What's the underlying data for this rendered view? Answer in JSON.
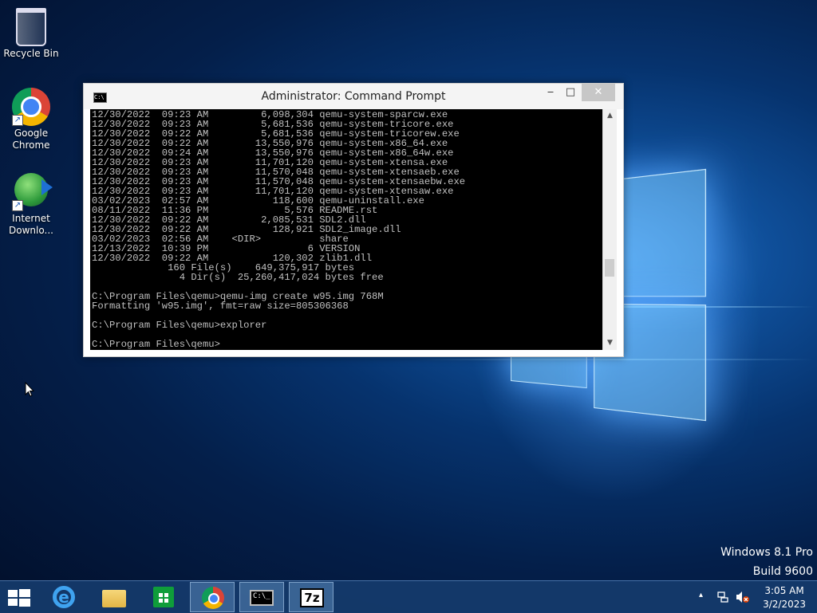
{
  "desktop": {
    "icons": [
      {
        "label": "Recycle Bin"
      },
      {
        "label": "Google Chrome"
      },
      {
        "label": "Internet Downlo..."
      }
    ],
    "watermark": {
      "line1": "Windows 8.1 Pro",
      "line2": "Build 9600"
    }
  },
  "window": {
    "title": "Administrator: Command Prompt",
    "minimize": "‒",
    "maximize": "□",
    "close": "✕",
    "console_lines": [
      "12/30/2022  09:23 AM         6,098,304 qemu-system-sparcw.exe",
      "12/30/2022  09:23 AM         5,681,536 qemu-system-tricore.exe",
      "12/30/2022  09:22 AM         5,681,536 qemu-system-tricorew.exe",
      "12/30/2022  09:22 AM        13,550,976 qemu-system-x86_64.exe",
      "12/30/2022  09:24 AM        13,550,976 qemu-system-x86_64w.exe",
      "12/30/2022  09:23 AM        11,701,120 qemu-system-xtensa.exe",
      "12/30/2022  09:23 AM        11,570,048 qemu-system-xtensaeb.exe",
      "12/30/2022  09:23 AM        11,570,048 qemu-system-xtensaebw.exe",
      "12/30/2022  09:23 AM        11,701,120 qemu-system-xtensaw.exe",
      "03/02/2023  02:57 AM           118,600 qemu-uninstall.exe",
      "08/11/2022  11:36 PM             5,576 README.rst",
      "12/30/2022  09:22 AM         2,085,531 SDL2.dll",
      "12/30/2022  09:22 AM           128,921 SDL2_image.dll",
      "03/02/2023  02:56 AM    <DIR>          share",
      "12/13/2022  10:39 PM                 6 VERSION",
      "12/30/2022  09:22 AM           120,302 zlib1.dll",
      "             160 File(s)    649,375,917 bytes",
      "               4 Dir(s)  25,260,417,024 bytes free",
      "",
      "C:\\Program Files\\qemu>qemu-img create w95.img 768M",
      "Formatting 'w95.img', fmt=raw size=805306368",
      "",
      "C:\\Program Files\\qemu>explorer",
      "",
      "C:\\Program Files\\qemu>"
    ]
  },
  "taskbar": {
    "apps": [
      {
        "name": "Internet Explorer"
      },
      {
        "name": "File Explorer"
      },
      {
        "name": "Store"
      },
      {
        "name": "Google Chrome"
      },
      {
        "name": "Command Prompt"
      },
      {
        "name": "7-Zip",
        "icon_text": "7z"
      }
    ],
    "clock": {
      "time": "3:05 AM",
      "date": "3/2/2023"
    },
    "tray_chevron": "▴"
  }
}
